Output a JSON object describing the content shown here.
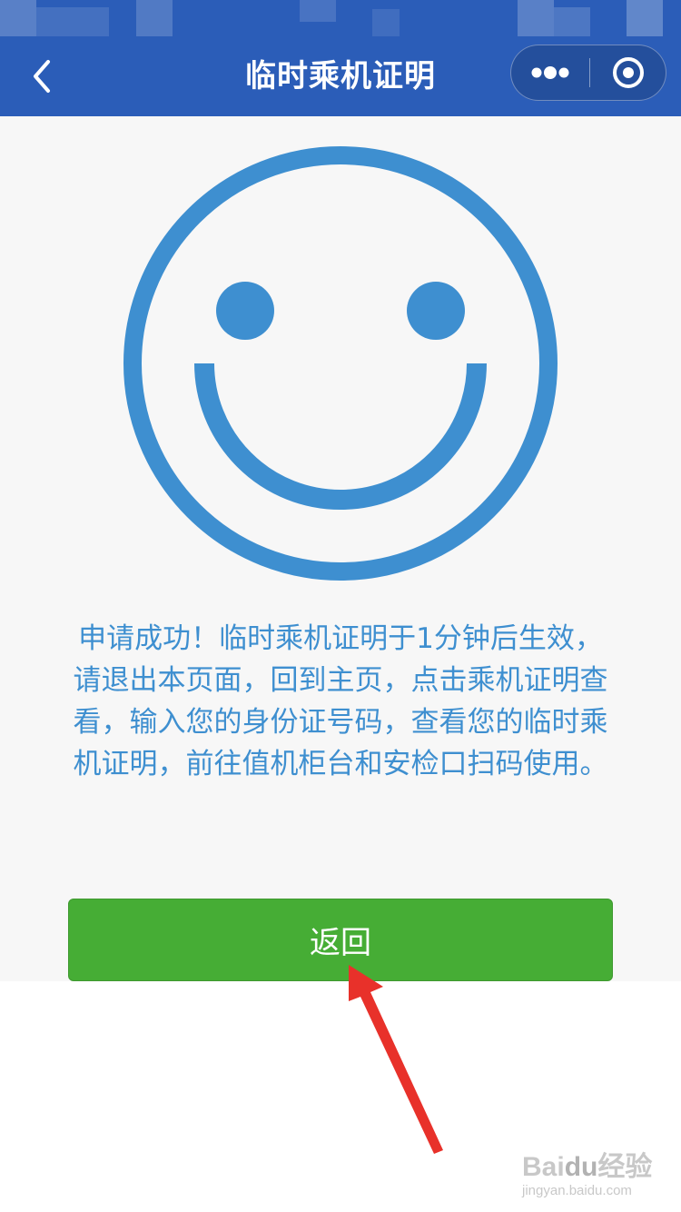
{
  "nav": {
    "title": "临时乘机证明",
    "back_icon": "chevron-left-icon",
    "more_icon": "more-dots-icon",
    "close_icon": "target-close-icon"
  },
  "result": {
    "icon": "smiley-face-icon",
    "message": "申请成功！临时乘机证明于1分钟后生效，请退出本页面，回到主页，点击乘机证明查看，输入您的身份证号码，查看您的临时乘机证明，前往值机柜台和安检口扫码使用。"
  },
  "actions": {
    "return_label": "返回"
  },
  "annotation": {
    "arrow_icon": "red-arrow-icon"
  },
  "watermark": {
    "logo_left": "Bai",
    "logo_paw": "du",
    "logo_right": "经验",
    "url": "jingyan.baidu.com"
  },
  "colors": {
    "nav_background": "#2b5db8",
    "accent_blue": "#3e8fd0",
    "button_green": "#46ad35",
    "annotation_red": "#e8312a"
  }
}
